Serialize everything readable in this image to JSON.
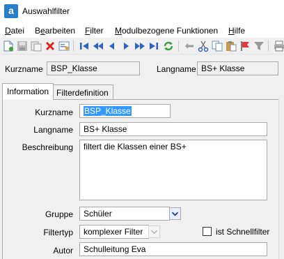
{
  "window": {
    "title": "Auswahlfilter",
    "app_icon_letter": "a"
  },
  "menu": [
    {
      "pre": "",
      "u": "D",
      "post": "atei"
    },
    {
      "pre": "B",
      "u": "e",
      "post": "arbeiten"
    },
    {
      "pre": "",
      "u": "F",
      "post": "ilter"
    },
    {
      "pre": "",
      "u": "M",
      "post": "odulbezogene Funktionen"
    },
    {
      "pre": "",
      "u": "H",
      "post": "ilfe"
    }
  ],
  "toolbar_icons": [
    "new-icon",
    "save-icon",
    "copy-record-icon",
    "delete-icon",
    "card-icon",
    "first-icon",
    "prev-page-icon",
    "prev-icon",
    "next-icon",
    "next-page-icon",
    "last-icon",
    "refresh-icon",
    "back-arrow-icon",
    "cut-icon",
    "copy-icon",
    "paste-icon",
    "flag-icon",
    "filter-icon",
    "print-icon"
  ],
  "header": {
    "kurzname_label": "Kurzname",
    "kurzname_value": "BSP_Klasse",
    "langname_label": "Langname",
    "langname_value": "BS+ Klasse"
  },
  "tabs": [
    "Information",
    "Filterdefinition"
  ],
  "form": {
    "kurzname_label": "Kurzname",
    "kurzname_value": "BSP_Klasse",
    "langname_label": "Langname",
    "langname_value": "BS+ Klasse",
    "beschreibung_label": "Beschreibung",
    "beschreibung_value": "filtert die Klassen einer BS+",
    "gruppe_label": "Gruppe",
    "gruppe_value": "Schüler",
    "filtertyp_label": "Filtertyp",
    "filtertyp_value": "komplexer Filter",
    "schnellfilter_label": "ist Schnellfilter",
    "schnellfilter_checked": false,
    "autor_label": "Autor",
    "autor_value": "Schulleitung Eva"
  }
}
